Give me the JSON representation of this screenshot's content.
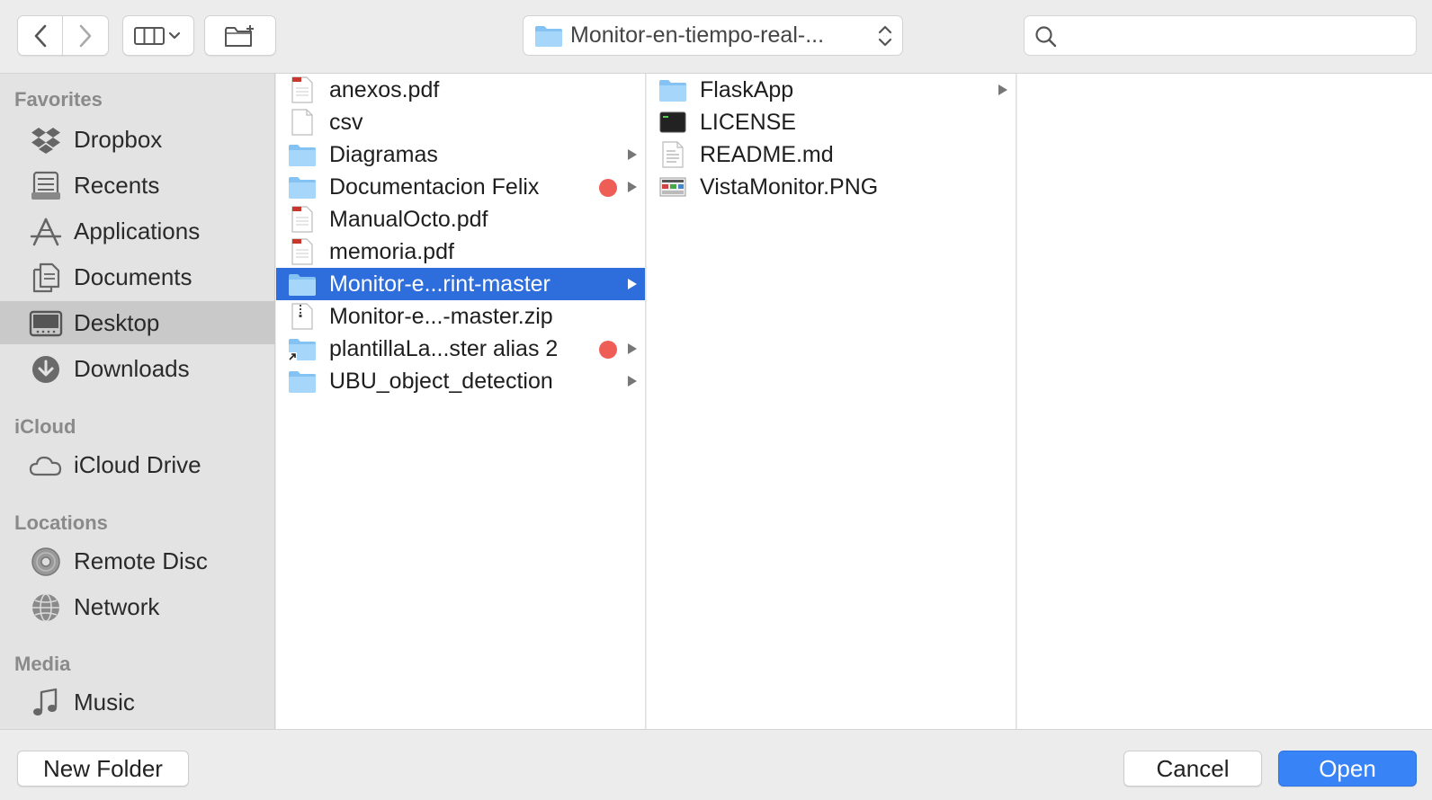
{
  "toolbar": {
    "back_icon": "chevron-left-icon",
    "forward_icon": "chevron-right-icon",
    "view_icon": "column-view-icon",
    "new_folder_icon": "new-folder-icon",
    "path_label": "Monitor-en-tiempo-real-...",
    "search_placeholder": ""
  },
  "sidebar": {
    "sections": [
      {
        "title": "Favorites",
        "items": [
          {
            "label": "Dropbox",
            "icon": "dropbox-icon"
          },
          {
            "label": "Recents",
            "icon": "recents-icon"
          },
          {
            "label": "Applications",
            "icon": "applications-icon"
          },
          {
            "label": "Documents",
            "icon": "documents-icon"
          },
          {
            "label": "Desktop",
            "icon": "desktop-icon",
            "selected": true
          },
          {
            "label": "Downloads",
            "icon": "downloads-icon"
          }
        ]
      },
      {
        "title": "iCloud",
        "items": [
          {
            "label": "iCloud Drive",
            "icon": "cloud-icon"
          }
        ]
      },
      {
        "title": "Locations",
        "items": [
          {
            "label": "Remote Disc",
            "icon": "disc-icon"
          },
          {
            "label": "Network",
            "icon": "network-icon"
          }
        ]
      },
      {
        "title": "Media",
        "items": [
          {
            "label": "Music",
            "icon": "music-icon"
          }
        ]
      }
    ]
  },
  "columns": {
    "col1": [
      {
        "label": "anexos.pdf",
        "kind": "pdf"
      },
      {
        "label": "csv",
        "kind": "file"
      },
      {
        "label": "Diagramas",
        "kind": "folder",
        "has_children": true
      },
      {
        "label": "Documentacion Felix",
        "kind": "folder",
        "has_children": true,
        "tag": "red"
      },
      {
        "label": "ManualOcto.pdf",
        "kind": "pdf"
      },
      {
        "label": "memoria.pdf",
        "kind": "pdf"
      },
      {
        "label": "Monitor-e...rint-master",
        "kind": "folder",
        "has_children": true,
        "selected": true
      },
      {
        "label": "Monitor-e...-master.zip",
        "kind": "zip"
      },
      {
        "label": "plantillaLa...ster alias 2",
        "kind": "alias",
        "has_children": true,
        "tag": "red"
      },
      {
        "label": "UBU_object_detection",
        "kind": "folder",
        "has_children": true
      }
    ],
    "col2": [
      {
        "label": "FlaskApp",
        "kind": "folder",
        "has_children": true
      },
      {
        "label": "LICENSE",
        "kind": "terminal"
      },
      {
        "label": "README.md",
        "kind": "text"
      },
      {
        "label": "VistaMonitor.PNG",
        "kind": "image"
      }
    ]
  },
  "buttons": {
    "new_folder": "New Folder",
    "cancel": "Cancel",
    "open": "Open"
  },
  "colors": {
    "selection": "#2d6ddc",
    "tag_red": "#ee5e57",
    "open_button": "#3883f6"
  }
}
